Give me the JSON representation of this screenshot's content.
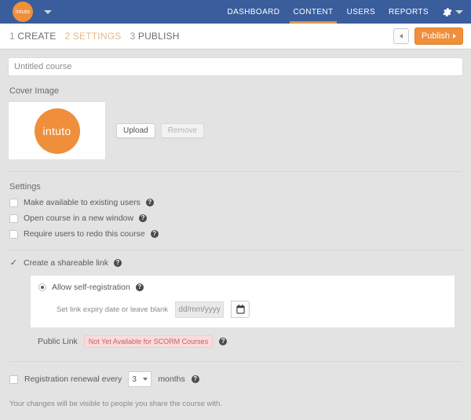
{
  "topnav": {
    "logo_text": "intuto",
    "logo_caret_icon": "chevron-down-icon",
    "links": [
      {
        "label": "DASHBOARD",
        "active": false
      },
      {
        "label": "CONTENT",
        "active": true
      },
      {
        "label": "USERS",
        "active": false
      },
      {
        "label": "REPORTS",
        "active": false
      }
    ],
    "settings_icon": "gear-icon",
    "settings_caret_icon": "chevron-down-icon",
    "bg_color": "#3a5d9c",
    "accent_color": "#ef8f3c"
  },
  "stepbar": {
    "steps": [
      {
        "num": "1",
        "label": "CREATE",
        "active": false
      },
      {
        "num": "2",
        "label": "SETTINGS",
        "active": true
      },
      {
        "num": "3",
        "label": "PUBLISH",
        "active": false
      }
    ],
    "back_icon": "left-arrow-icon",
    "publish_label": "Publish",
    "publish_arrow_icon": "right-arrow-icon"
  },
  "course": {
    "title_placeholder": "Untitled course",
    "title_value": ""
  },
  "cover": {
    "label": "Cover Image",
    "image_text": "intuto",
    "image_color": "#ef8f3c",
    "upload_label": "Upload",
    "remove_label": "Remove",
    "remove_disabled": true
  },
  "settings": {
    "label": "Settings",
    "checkboxes": [
      {
        "label": "Make available to existing users",
        "checked": false,
        "help_icon": "help-icon"
      },
      {
        "label": "Open course in a new window",
        "checked": false,
        "help_icon": "help-icon"
      },
      {
        "label": "Require users to redo this course",
        "checked": false,
        "help_icon": "help-icon"
      }
    ]
  },
  "shareable": {
    "label": "Create a shareable link",
    "checked": true,
    "check_icon": "check-icon",
    "self_registration": {
      "label": "Allow self-registration",
      "selected": true
    },
    "expiry": {
      "label": "Set link expiry date or leave blank",
      "placeholder": "dd/mm/yyyy",
      "value": "",
      "calendar_icon": "calendar-icon"
    },
    "public_link": {
      "label": "Public Link",
      "badge": "Not Yet Available for SCORM Courses",
      "badge_color": "#c96060"
    }
  },
  "renewal": {
    "label_before": "Registration renewal every",
    "value": "3",
    "label_after": "months",
    "checked": false,
    "caret_icon": "chevron-down-icon"
  },
  "footer": {
    "note": "Your changes will be visible to people you share the course with."
  }
}
